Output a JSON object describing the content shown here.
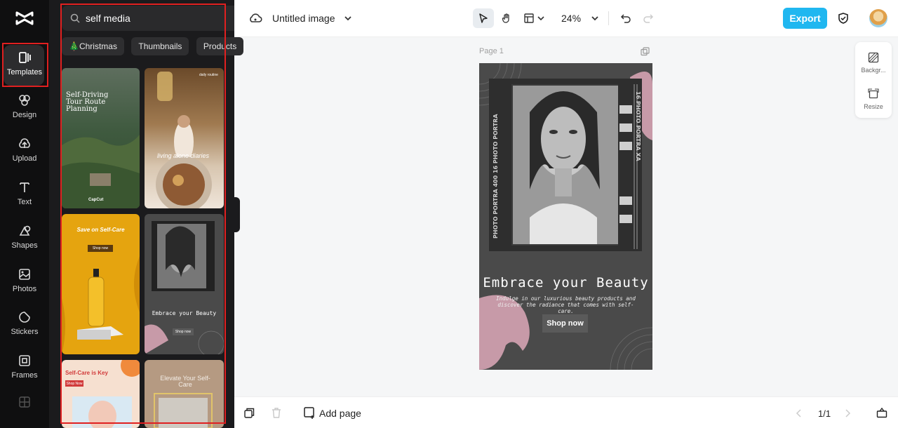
{
  "app": {
    "rail": [
      {
        "key": "templates",
        "label": "Templates",
        "icon": "templates-icon",
        "active": true
      },
      {
        "key": "design",
        "label": "Design",
        "icon": "design-icon"
      },
      {
        "key": "upload",
        "label": "Upload",
        "icon": "upload-icon"
      },
      {
        "key": "text",
        "label": "Text",
        "icon": "text-icon"
      },
      {
        "key": "shapes",
        "label": "Shapes",
        "icon": "shapes-icon"
      },
      {
        "key": "photos",
        "label": "Photos",
        "icon": "photos-icon"
      },
      {
        "key": "stickers",
        "label": "Stickers",
        "icon": "stickers-icon"
      },
      {
        "key": "frames",
        "label": "Frames",
        "icon": "frames-icon"
      }
    ]
  },
  "search": {
    "query": "self media"
  },
  "chips": [
    "🎄Christmas",
    "Thumbnails",
    "Products"
  ],
  "templates": [
    {
      "title": "Self-Driving Tour Route Planning",
      "brand": "CapCut"
    },
    {
      "title": "living alone diaries",
      "tag": "daily routine"
    },
    {
      "title": "Save on Self-Care",
      "cta": "Shop now"
    },
    {
      "title": "Embrace your Beauty",
      "cta": "Shop now"
    },
    {
      "title": "Self-Care is Key",
      "cta": "Shop Now"
    },
    {
      "title": "Elevate Your Self-Care"
    }
  ],
  "topbar": {
    "title": "Untitled image",
    "zoom": "24%",
    "export_label": "Export"
  },
  "canvas": {
    "page_label": "Page 1",
    "design": {
      "film_text_left": "PHOTO PORTRA 400  16  PHOTO PORTRA",
      "film_text_right": "16  PHOTO PORTRA  XA",
      "title": "Embrace your Beauty",
      "subtitle": "Indulge in our luxurious beauty products and discover the radiance that comes with self-care.",
      "cta": "Shop now"
    }
  },
  "side_tools": [
    {
      "label": "Backgr...",
      "icon": "background-icon"
    },
    {
      "label": "Resize",
      "icon": "resize-icon"
    }
  ],
  "bottombar": {
    "add_page_label": "Add page",
    "pager": "1/1"
  },
  "colors": {
    "accent": "#20b7f0",
    "highlight": "#e02020",
    "panel_bg": "#1b1b1d",
    "rail_bg": "#0f0f10",
    "design_bg": "#4a4a4a",
    "design_pink": "#c79aa8"
  }
}
